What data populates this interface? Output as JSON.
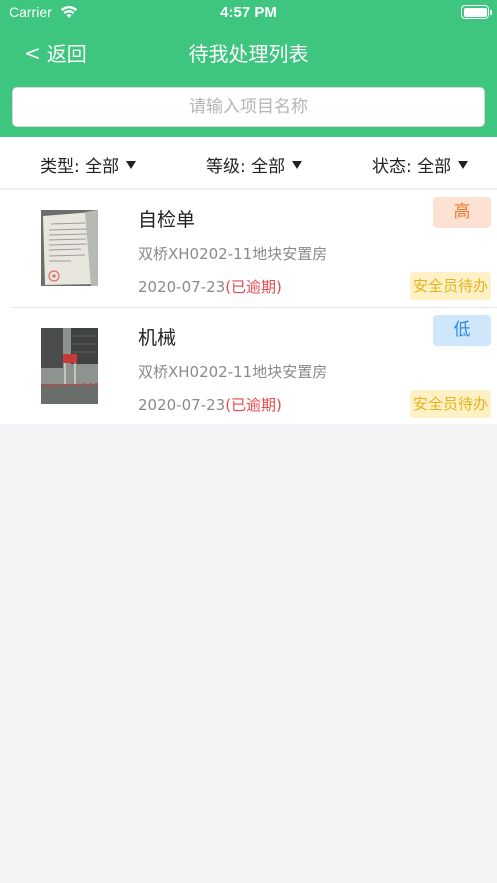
{
  "statusbar": {
    "carrier": "Carrier",
    "time": "4:57 PM"
  },
  "navbar": {
    "back_label": "返回",
    "back_chevron": "<",
    "title": "待我处理列表"
  },
  "search": {
    "placeholder": "请输入项目名称",
    "value": ""
  },
  "filters": [
    {
      "label": "类型:",
      "value": "全部"
    },
    {
      "label": "等级:",
      "value": "全部"
    },
    {
      "label": "状态:",
      "value": "全部"
    }
  ],
  "items": [
    {
      "title": "自检单",
      "project": "双桥XH0202-11地块安置房",
      "date": "2020-07-23",
      "overdue": "(已逾期)",
      "level": "高",
      "status": "安全员待办"
    },
    {
      "title": "机械",
      "project": "双桥XH0202-11地块安置房",
      "date": "2020-07-23",
      "overdue": "(已逾期)",
      "level": "低",
      "status": "安全员待办"
    }
  ],
  "colors": {
    "brand_green": "#3ec57f",
    "overdue_red": "#e5484d",
    "level_high": "#f07a2e",
    "level_low": "#2d8ae0",
    "status_yellow": "#e6b21b"
  }
}
